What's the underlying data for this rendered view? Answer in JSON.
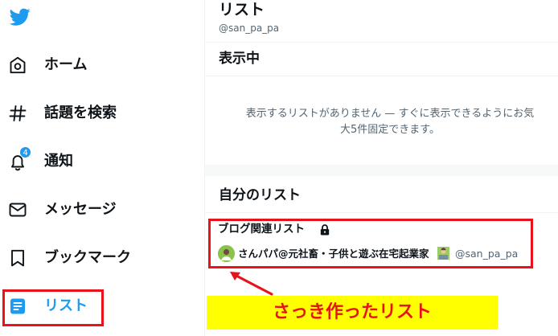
{
  "sidebar": {
    "items": [
      {
        "label": "ホーム",
        "icon": "home-icon"
      },
      {
        "label": "話題を検索",
        "icon": "hashtag-icon"
      },
      {
        "label": "通知",
        "icon": "bell-icon",
        "badge": "4"
      },
      {
        "label": "メッセージ",
        "icon": "envelope-icon"
      },
      {
        "label": "ブックマーク",
        "icon": "bookmark-icon"
      },
      {
        "label": "リスト",
        "icon": "list-icon",
        "active": true
      }
    ]
  },
  "header": {
    "title": "リスト",
    "handle": "@san_pa_pa"
  },
  "pinned": {
    "title": "表示中",
    "empty_line1": "表示するリストがありません — すぐに表示できるようにお気",
    "empty_line2": "大5件固定できます。"
  },
  "my_lists": {
    "title": "自分のリスト",
    "items": [
      {
        "name": "ブログ関連リスト",
        "private": true,
        "owner_name": "さんパパ@元社畜・子供と遊ぶ在宅起業家",
        "owner_handle": "@san_pa_pa"
      }
    ]
  },
  "annotation": {
    "callout": "さっき作ったリスト"
  },
  "colors": {
    "accent": "#1d9bf0",
    "annotation_red": "#e8121b",
    "callout_bg": "#ffff00"
  }
}
